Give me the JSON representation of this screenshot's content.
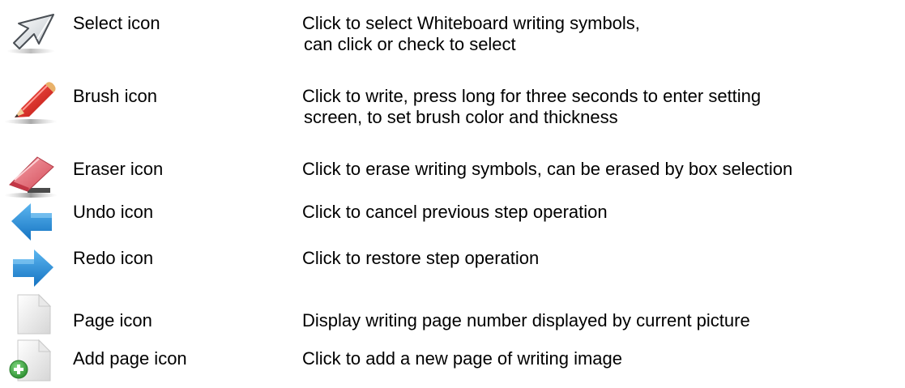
{
  "rows": [
    {
      "icon": "select-icon",
      "name": "Select icon",
      "desc_lines": [
        "Click to select Whiteboard writing symbols,",
        "can click or check to select"
      ]
    },
    {
      "icon": "brush-icon",
      "name": "Brush icon",
      "desc_lines": [
        "Click to write, press long for three seconds to enter setting",
        "screen, to set brush color and thickness"
      ]
    },
    {
      "icon": "eraser-icon",
      "name": "Eraser icon",
      "desc_lines": [
        "Click to erase writing symbols, can be erased by box selection"
      ]
    },
    {
      "icon": "undo-icon",
      "name": "Undo icon",
      "desc_lines": [
        "Click to cancel previous step operation"
      ]
    },
    {
      "icon": "redo-icon",
      "name": "Redo icon",
      "desc_lines": [
        "Click to restore step operation"
      ]
    },
    {
      "icon": "page-icon",
      "name": "Page icon",
      "desc_lines": [
        "Display writing page number displayed by current picture"
      ]
    },
    {
      "icon": "add-page-icon",
      "name": "Add page icon",
      "desc_lines": [
        "Click to add a new page of writing image"
      ]
    }
  ],
  "colors": {
    "text": "#000000",
    "arrow_blue": "#1f8ad8",
    "pencil_red": "#e0231c",
    "eraser_pink": "#e8737e",
    "add_green": "#3aa33d"
  }
}
